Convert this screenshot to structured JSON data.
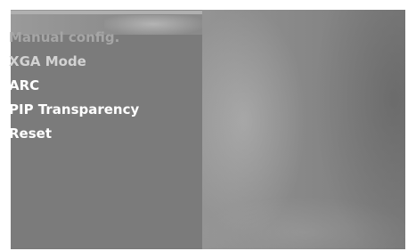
{
  "menu": {
    "items": [
      {
        "label": "Manual config.",
        "state": "disabled"
      },
      {
        "label": "XGA Mode",
        "state": "dimmed"
      },
      {
        "label": "ARC",
        "state": "enabled"
      },
      {
        "label": "PIP Transparency",
        "state": "enabled"
      },
      {
        "label": "Reset",
        "state": "enabled"
      }
    ]
  },
  "colors": {
    "menu_panel": "#7b7b7b",
    "item_text": "#ffffff",
    "item_disabled": "#a6a6a6",
    "item_dimmed": "#d3d3d3"
  }
}
